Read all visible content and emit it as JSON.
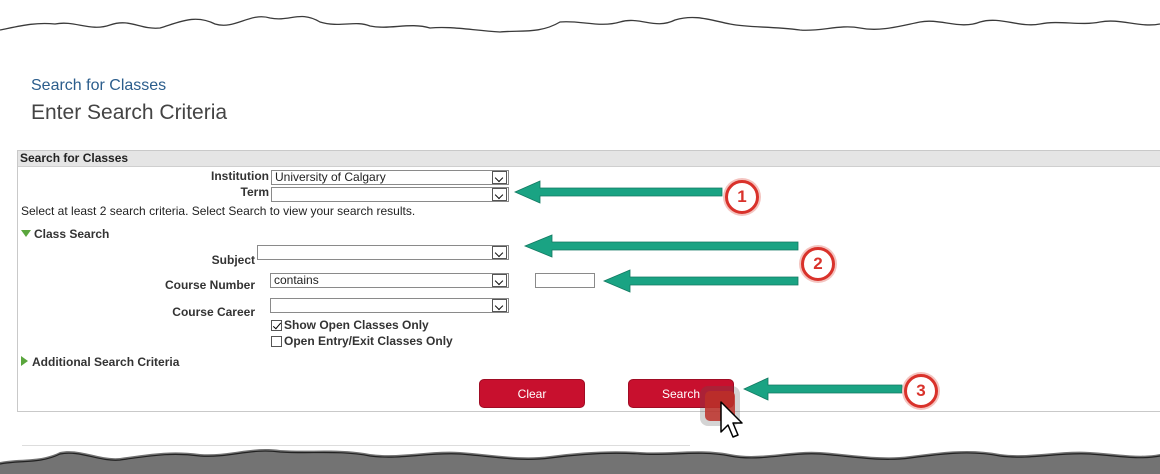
{
  "breadcrumb": "Search for Classes",
  "page_title": "Enter Search Criteria",
  "panel": {
    "header": "Search for Classes",
    "institution": {
      "label": "Institution",
      "value": "University of Calgary"
    },
    "term": {
      "label": "Term",
      "value": ""
    },
    "instruction": "Select at least 2 search criteria. Select Search to view your search results.",
    "class_search_label": "Class Search",
    "subject": {
      "label": "Subject",
      "value": ""
    },
    "course_number": {
      "label": "Course Number",
      "operator": "contains",
      "value": ""
    },
    "course_career": {
      "label": "Course Career",
      "value": ""
    },
    "show_open_only": {
      "label": "Show Open Classes Only",
      "checked": true
    },
    "open_entry_exit": {
      "label": "Open Entry/Exit Classes Only",
      "checked": false
    },
    "additional_label": "Additional Search Criteria",
    "clear_label": "Clear",
    "search_label": "Search"
  },
  "callouts": {
    "one": "1",
    "two": "2",
    "three": "3"
  },
  "colors": {
    "brand_button": "#c8102e",
    "arrow": "#1aa383",
    "callout": "#d9322b",
    "link": "#2b5d8c"
  },
  "icons": [
    "chevron-down-icon",
    "expand-triangle-icon",
    "collapsed-triangle-icon",
    "checkmark-icon",
    "arrow-left-icon",
    "mouse-pointer-icon"
  ]
}
